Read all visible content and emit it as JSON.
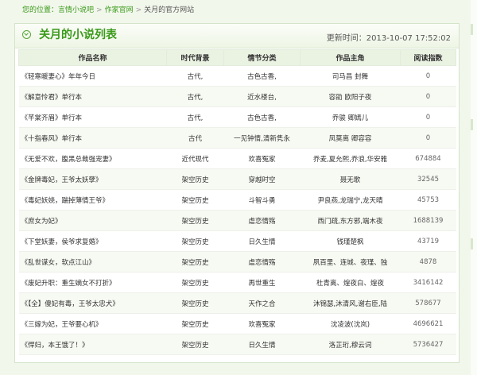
{
  "breadcrumb": {
    "prefix": "您的位置：",
    "items": [
      "言情小说吧",
      "作家官网",
      "关月的官方网站"
    ]
  },
  "panel": {
    "title": "关月的小说列表",
    "updated_label": "更新时间：",
    "updated_value": "2013-10-07 17:52:02"
  },
  "table": {
    "headers": [
      "作品名称",
      "时代背景",
      "情节分类",
      "作品主角",
      "阅读指数"
    ],
    "rows": [
      [
        "《轻寒暖妻心》年年今日",
        "古代,",
        "古色古香,",
        "司马昌  封舞",
        "0"
      ],
      [
        "《解意怜君》单行本",
        "古代,",
        "近水楼台,",
        "容劭  欧阳子夜",
        "0"
      ],
      [
        "《芊棠齐眉》单行本",
        "古代,",
        "古色古香,",
        "乔骏  卿嫣儿",
        "0"
      ],
      [
        "《十指春风》单行本",
        "古代",
        "一见钟情,清新隽永",
        "凤莫离  卿容容",
        "0"
      ],
      [
        "《无爱不欢，腹黑总裁强宠妻》",
        "近代现代",
        "欢喜冤家",
        "乔麦,夏允熙,乔浪,华安雅",
        "674884"
      ],
      [
        "《金牌毒妃，王爷太妖孽》",
        "架空历史",
        "穿越时空",
        "聂无歌",
        "32545"
      ],
      [
        "《毒妃妖娆，踹掉薄情王爷》",
        "架空历史",
        "斗智斗勇",
        "尹良燕,龙瑞宁,龙天晴",
        "45753"
      ],
      [
        "《庶女为妃》",
        "架空历史",
        "虐恋情殇",
        "西门疏,东方邪,端木夜",
        "1688139"
      ],
      [
        "《下堂妖妻，侯爷求复婚》",
        "架空历史",
        "日久生情",
        "钱瑾楚枫",
        "43719"
      ],
      [
        "《乱世谋女，软点江山》",
        "架空历史",
        "虐恋情殇",
        "夙百里、连城、夜瑾、独",
        "4878"
      ],
      [
        "《废妃升职：重生嫡女不打折》",
        "架空历史",
        "再世重生",
        "杜青离、煌夜白、煌夜",
        "3416142"
      ],
      [
        "《【全】傻妃有毒，王爷太忠犬》",
        "架空历史",
        "天作之合",
        "沐锦瑟,沐清风,谢右臣,陆",
        "578677"
      ],
      [
        "《三嫁为妃，王爷要心机》",
        "架空历史",
        "欢喜冤家",
        "沈凌波(沈岚)",
        "4696621"
      ],
      [
        "《悍妇，本王饿了！》",
        "架空历史",
        "日久生情",
        "洛芷珩,穆云词",
        "5736427"
      ]
    ]
  },
  "colors": {
    "accent": "#3a9a1a",
    "background": "#f2f7ec",
    "header_row": "#eaf2e2"
  },
  "icons": {
    "title_icon": "chevron-down-circle-icon"
  }
}
